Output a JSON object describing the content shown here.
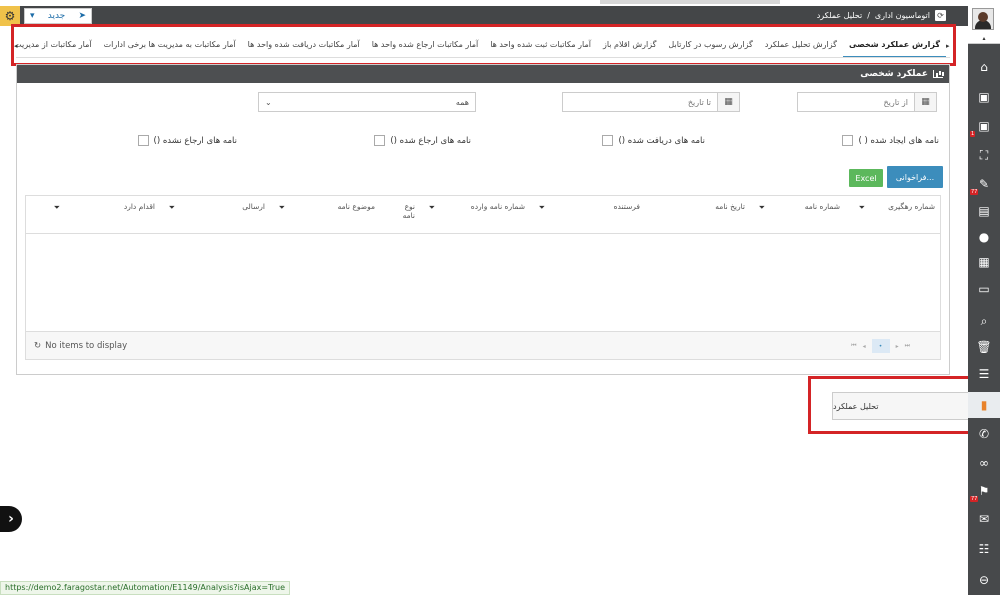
{
  "header": {
    "breadcrumb_root": "اتوماسیون اداری",
    "breadcrumb_sep": "/",
    "breadcrumb_current": "تحلیل عملکرد",
    "new_button": "جدید"
  },
  "tabs": [
    {
      "label": "گزارش عملکرد شخصی",
      "active": true
    },
    {
      "label": "گزارش تحلیل عملکرد",
      "active": false
    },
    {
      "label": "گزارش رسوب در کارتابل",
      "active": false
    },
    {
      "label": "گزارش اقلام باز",
      "active": false
    },
    {
      "label": "آمار مکاتبات ثبت شده واحد ها",
      "active": false
    },
    {
      "label": "آمار مکاتبات ارجاع شده واحد ها",
      "active": false
    },
    {
      "label": "آمار مکاتبات دریافت شده واحد ها",
      "active": false
    },
    {
      "label": "آمار مکاتبات به مدیریت ها برخی ادارات",
      "active": false
    },
    {
      "label": "آمار مکاتبات از مدیریت ها برخی",
      "active": false
    }
  ],
  "panel": {
    "title": "عملکرد شخصی",
    "from_date_placeholder": "از تاریخ",
    "to_date_placeholder": "تا تاریخ",
    "select_value": "همه",
    "checkboxes": {
      "created": "نامه های ایجاد شده ( )",
      "received": "نامه های دریافت شده ()",
      "referred": "نامه های ارجاع شده ()",
      "not_referred": "نامه های ارجاع نشده ()"
    },
    "recall_button": "فراخوانی...",
    "excel_button": "Excel"
  },
  "grid": {
    "columns": {
      "tracking": "شماره رهگیری",
      "letter_no": "شماره نامه",
      "letter_date": "تاریخ نامه",
      "sender": "فرستنده",
      "incoming_no": "شماره نامه وارده",
      "letter_type": "نوع نامه",
      "subject": "موضوع نامه",
      "sent": "ارسالی",
      "action": "اقدام دارد"
    },
    "empty_text": "No items to display",
    "current_page": "•"
  },
  "tooltip": {
    "label": "تحلیل عملکرد"
  },
  "status_bar": {
    "url": "https://demo2.faragostar.net/Automation/E1149/Analysis?isAjax=True"
  },
  "sidebar": {
    "badges": {
      "inbox": "1",
      "drafts": "77",
      "flag": "77"
    }
  },
  "colors": {
    "accent": "#3c8dbc",
    "highlight_border": "#d42426",
    "excel": "#5cb85c",
    "sidebar_bg": "#47494b",
    "active_icon": "#e8822a"
  }
}
